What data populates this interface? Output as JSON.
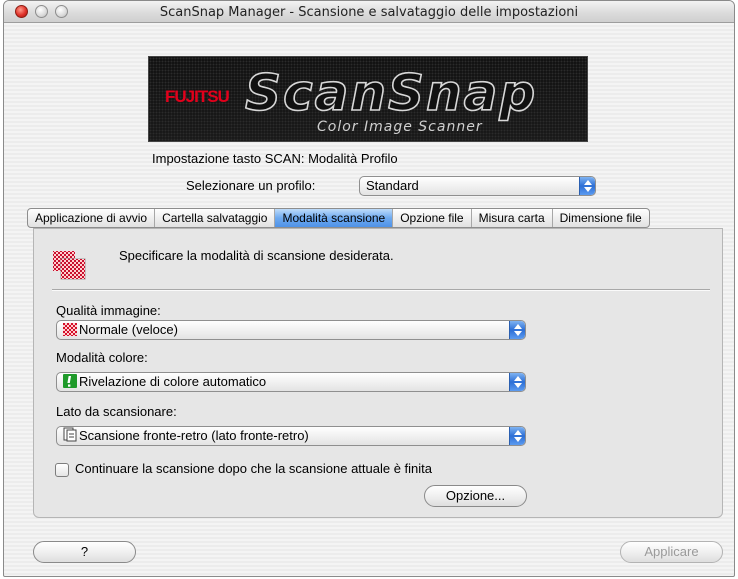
{
  "window": {
    "title": "ScanSnap Manager - Scansione e salvataggio delle impostazioni"
  },
  "logo": {
    "brand": "FUJITSU",
    "product": "ScanSnap",
    "subtitle": "Color Image Scanner"
  },
  "scan_button_setting": "Impostazione tasto SCAN: Modalità Profilo",
  "profile": {
    "label": "Selezionare un profilo:",
    "value": "Standard"
  },
  "tabs": [
    {
      "label": "Applicazione di avvio",
      "active": false
    },
    {
      "label": "Cartella salvataggio",
      "active": false
    },
    {
      "label": "Modalità scansione",
      "active": true
    },
    {
      "label": "Opzione file",
      "active": false
    },
    {
      "label": "Misura carta",
      "active": false
    },
    {
      "label": "Dimensione file",
      "active": false
    }
  ],
  "panel": {
    "instruction": "Specificare la modalità di scansione desiderata.",
    "icon": "scan-mode-checker-icon",
    "image_quality": {
      "label": "Qualità immagine:",
      "value": "Normale (veloce)",
      "icon": "checker-quality-icon"
    },
    "color_mode": {
      "label": "Modalità colore:",
      "value": "Rivelazione di colore automatico",
      "icon": "auto-color-icon"
    },
    "scan_side": {
      "label": "Lato da scansionare:",
      "value": "Scansione fronte-retro (lato fronte-retro)",
      "icon": "duplex-page-icon"
    },
    "continue_scan": {
      "label": "Continuare la scansione dopo che la scansione attuale è finita",
      "checked": false
    },
    "option_button": "Opzione..."
  },
  "footer": {
    "help_button": "?",
    "apply_button": "Applicare"
  },
  "colors": {
    "accent": "#4f92e8",
    "brand_red": "#e3001b",
    "auto_color_green": "#1f9a2a"
  }
}
